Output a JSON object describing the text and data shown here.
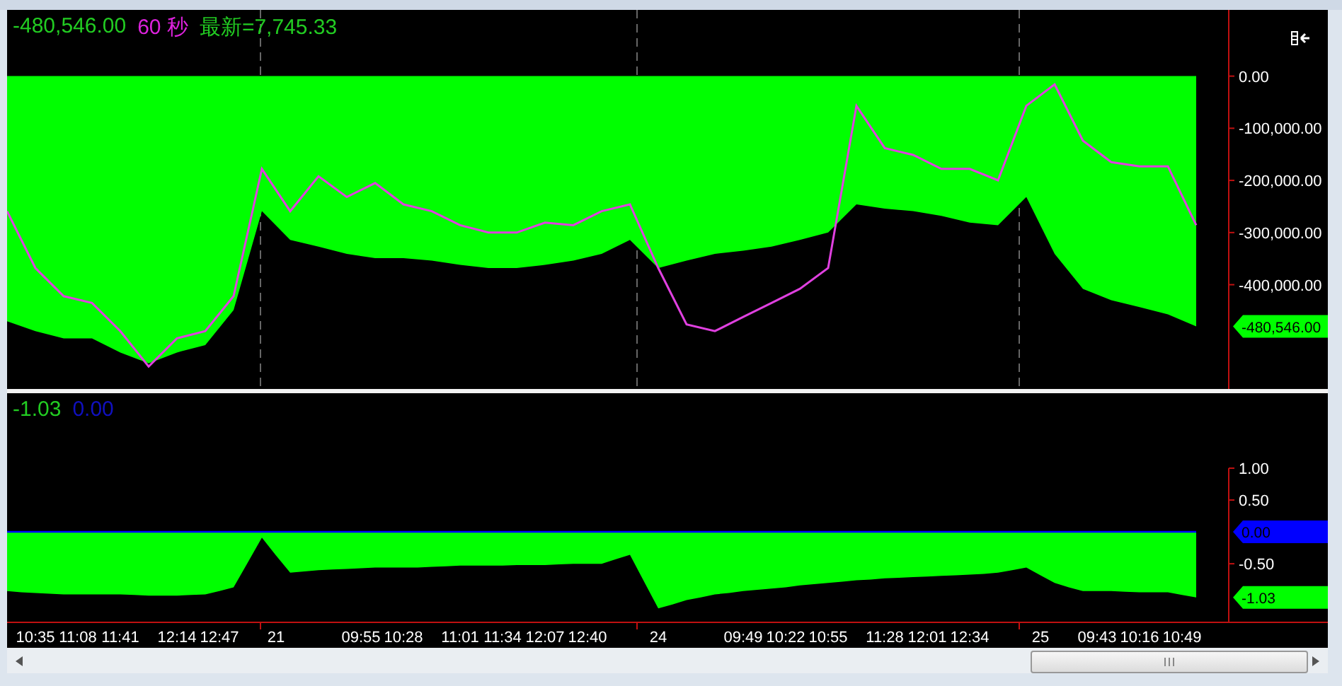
{
  "top_pane": {
    "header": [
      {
        "text": "-480,546.00",
        "color": "#22cc22"
      },
      {
        "text": "60 秒",
        "color": "#dd22dd"
      },
      {
        "text": "最新=7,745.33",
        "color": "#22cc22"
      }
    ],
    "chart_data": {
      "type": "area",
      "ylim": [
        -600000,
        127000
      ],
      "yticks": [
        {
          "value": 0,
          "label": "0.00"
        },
        {
          "value": -100000,
          "label": "-100,000.00"
        },
        {
          "value": -200000,
          "label": "-200,000.00"
        },
        {
          "value": -300000,
          "label": "-300,000.00"
        },
        {
          "value": -400000,
          "label": "-400,000.00"
        }
      ],
      "series": [
        {
          "type": "area",
          "color": "#00ff00",
          "values": [
            -470000,
            -489000,
            -503000,
            -503000,
            -530000,
            -551000,
            -530000,
            -516000,
            -449000,
            -259000,
            -314000,
            -327000,
            -341000,
            -349000,
            -349000,
            -354000,
            -362000,
            -368000,
            -368000,
            -362000,
            -354000,
            -341000,
            -314000,
            -368000,
            -354000,
            -341000,
            -335000,
            -327000,
            -314000,
            -300000,
            -246000,
            -254000,
            -259000,
            -268000,
            -281000,
            -286000,
            -232000,
            -341000,
            -408000,
            -430000,
            -443000,
            -457000,
            -480000
          ]
        },
        {
          "type": "line",
          "color": "#e040e0",
          "values": [
            -259000,
            -368000,
            -422000,
            -435000,
            -489000,
            -557000,
            -503000,
            -489000,
            -422000,
            -178000,
            -259000,
            -192000,
            -232000,
            -205000,
            -246000,
            -259000,
            -286000,
            -300000,
            -300000,
            -281000,
            -286000,
            -259000,
            -246000,
            -368000,
            -476000,
            -489000,
            -462000,
            -435000,
            -408000,
            -368000,
            -57000,
            -138000,
            -151000,
            -178000,
            -178000,
            -200000,
            -57000,
            -16000,
            -124000,
            -165000,
            -173000,
            -173000,
            -286000
          ]
        }
      ]
    },
    "value_tags": [
      {
        "text": "-480,546.00",
        "color": "#00ff00"
      }
    ]
  },
  "bottom_pane": {
    "header": [
      {
        "text": "-1.03",
        "color": "#22cc22"
      },
      {
        "text": "0.00",
        "color": "#1010c0"
      }
    ],
    "chart_data": {
      "type": "area",
      "ylim": [
        -1.42,
        1.0
      ],
      "categories": [
        null,
        null,
        "10:35",
        null,
        null,
        "11:08",
        null,
        null,
        "11:41",
        null,
        null,
        null,
        "12:14",
        null,
        null,
        "12:47",
        null,
        null,
        null,
        "21",
        null,
        null,
        null,
        null,
        null,
        "09:55",
        null,
        null,
        "10:28",
        null,
        null,
        null,
        "11:01",
        null,
        null,
        "11:34",
        null,
        null,
        "12:07",
        null,
        null,
        "12:40",
        null,
        null,
        null,
        null,
        "24",
        null,
        null,
        null,
        null,
        null,
        "09:49",
        null,
        null,
        "10:22",
        null,
        null,
        "10:55",
        null,
        null,
        null,
        "11:28",
        null,
        null,
        "12:01",
        null,
        null,
        "12:34",
        null,
        null,
        null,
        null,
        "25",
        null,
        null,
        null,
        "09:43",
        null,
        null,
        "10:16",
        null,
        null,
        "10:49",
        null
      ],
      "yticks": [
        {
          "value": 1,
          "label": "1.00"
        },
        {
          "value": 0.5,
          "label": "0.50"
        },
        {
          "value": -0.5,
          "label": "-0.50"
        }
      ],
      "series": [
        {
          "type": "line",
          "color": "#0000ff",
          "values": [
            0,
            0,
            0,
            0,
            0,
            0,
            0,
            0,
            0,
            0,
            0,
            0,
            0,
            0,
            0,
            0,
            0,
            0,
            0,
            0,
            0,
            0,
            0,
            0,
            0,
            0,
            0,
            0,
            0,
            0,
            0,
            0,
            0,
            0,
            0,
            0,
            0,
            0,
            0,
            0,
            0,
            0,
            0,
            0,
            0,
            0,
            0,
            0,
            0,
            0,
            0,
            0,
            0,
            0,
            0,
            0,
            0,
            0,
            0,
            0,
            0,
            0,
            0,
            0,
            0,
            0,
            0,
            0,
            0,
            0,
            0,
            0,
            0,
            0,
            0,
            0,
            0,
            0,
            0,
            0,
            0,
            0,
            0,
            0,
            0
          ]
        },
        {
          "type": "area",
          "color": "#00ff00",
          "values": [
            -0.93,
            -0.95,
            -0.96,
            -0.97,
            -0.98,
            -0.98,
            -0.98,
            -0.98,
            -0.98,
            -0.99,
            -1.0,
            -1.0,
            -1.0,
            -0.99,
            -0.98,
            -0.93,
            -0.87,
            -0.48,
            -0.09,
            -0.37,
            -0.64,
            -0.62,
            -0.6,
            -0.59,
            -0.58,
            -0.57,
            -0.56,
            -0.56,
            -0.56,
            -0.56,
            -0.55,
            -0.54,
            -0.53,
            -0.53,
            -0.53,
            -0.53,
            -0.52,
            -0.52,
            -0.52,
            -0.51,
            -0.5,
            -0.5,
            -0.5,
            -0.43,
            -0.36,
            -0.78,
            -1.2,
            -1.14,
            -1.07,
            -1.03,
            -0.98,
            -0.96,
            -0.93,
            -0.91,
            -0.89,
            -0.87,
            -0.84,
            -0.82,
            -0.8,
            -0.78,
            -0.76,
            -0.75,
            -0.73,
            -0.72,
            -0.71,
            -0.7,
            -0.69,
            -0.68,
            -0.67,
            -0.66,
            -0.64,
            -0.6,
            -0.56,
            -0.68,
            -0.8,
            -0.87,
            -0.93,
            -0.93,
            -0.93,
            -0.94,
            -0.95,
            -0.95,
            -0.95,
            -0.99,
            -1.03
          ]
        }
      ]
    },
    "value_tags": [
      {
        "text": "0.00",
        "color": "#0000ff"
      },
      {
        "text": "-1.03",
        "color": "#00ff00"
      }
    ]
  }
}
